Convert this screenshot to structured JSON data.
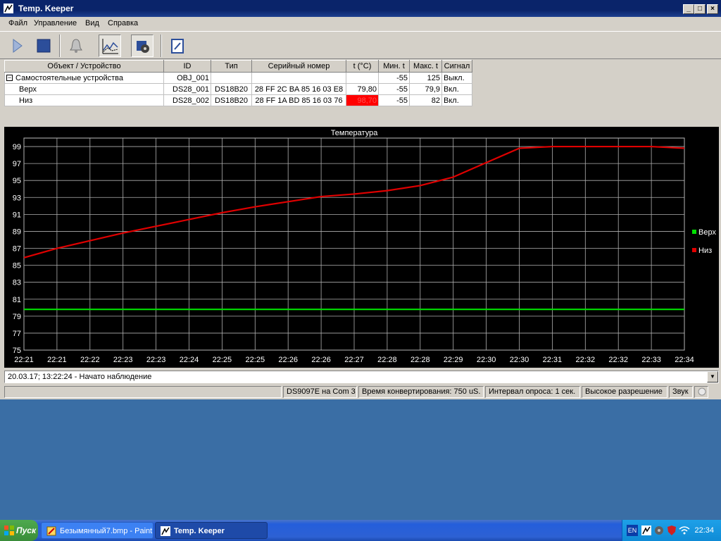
{
  "window": {
    "title": "Temp. Keeper",
    "controls": {
      "minimize": "_",
      "maximize": "□",
      "close": "×"
    }
  },
  "menu": [
    "Файл",
    "Управление",
    "Вид",
    "Справка"
  ],
  "toolbar": {
    "buttons": [
      "play-icon",
      "stop-icon",
      "bell-icon",
      "chart-icon",
      "devices-icon",
      "edit-icon"
    ]
  },
  "table": {
    "headers": [
      "Объект / Устройство",
      "ID",
      "Тип",
      "Серийный номер",
      "t (°C)",
      "Мин. t",
      "Макс. t",
      "Сигнал"
    ],
    "group": {
      "expander": "−",
      "name": "Самостоятельные устройства",
      "id": "OBJ_001",
      "type": "",
      "serial": "",
      "t": "",
      "min": "-55",
      "max": "125",
      "signal": "Выкл."
    },
    "rows": [
      {
        "name": "Верх",
        "id": "DS28_001",
        "type": "DS18B20",
        "serial": "28 FF 2C BA 85 16 03 E8",
        "t": "79,80",
        "min": "-55",
        "max": "79,9",
        "signal": "Вкл.",
        "alarm": false
      },
      {
        "name": "Низ",
        "id": "DS28_002",
        "type": "DS18B20",
        "serial": "28 FF 1A BD 85 16 03 76",
        "t": "98,70",
        "min": "-55",
        "max": "82",
        "signal": "Вкл.",
        "alarm": true
      }
    ]
  },
  "chart_data": {
    "type": "line",
    "title": "Температура",
    "xlabel": "",
    "ylabel": "",
    "ylim": [
      75,
      100
    ],
    "yticks": [
      75,
      77,
      79,
      81,
      83,
      85,
      87,
      89,
      91,
      93,
      95,
      97,
      99
    ],
    "xticks": [
      "22:21",
      "22:21",
      "22:22",
      "22:23",
      "22:23",
      "22:24",
      "22:25",
      "22:25",
      "22:26",
      "22:26",
      "22:27",
      "22:28",
      "22:28",
      "22:29",
      "22:30",
      "22:30",
      "22:31",
      "22:32",
      "22:32",
      "22:33",
      "22:34"
    ],
    "grid": true,
    "legend_position": "right",
    "background": "#000000",
    "series": [
      {
        "name": "Верх",
        "color": "#00e000",
        "x": [
          0,
          1,
          2,
          3,
          4,
          5,
          6,
          7,
          8,
          9,
          10,
          11,
          12,
          13,
          14,
          15,
          16,
          17,
          18,
          19,
          20
        ],
        "y": [
          79.8,
          79.8,
          79.8,
          79.8,
          79.8,
          79.8,
          79.8,
          79.8,
          79.8,
          79.8,
          79.8,
          79.8,
          79.8,
          79.8,
          79.8,
          79.8,
          79.8,
          79.8,
          79.8,
          79.8,
          79.8
        ]
      },
      {
        "name": "Низ",
        "color": "#e00000",
        "x": [
          0,
          1,
          2,
          3,
          4,
          5,
          6,
          7,
          8,
          9,
          10,
          11,
          12,
          13,
          14,
          15,
          16,
          17,
          18,
          19,
          20
        ],
        "y": [
          85.9,
          87.0,
          87.9,
          88.8,
          89.6,
          90.4,
          91.2,
          91.9,
          92.5,
          93.1,
          93.4,
          93.8,
          94.4,
          95.4,
          97.1,
          98.8,
          99.0,
          99.0,
          99.0,
          99.0,
          98.8
        ]
      }
    ]
  },
  "log": {
    "text": "20.03.17; 13:22:24 - Начато наблюдение",
    "dropdown": "▼"
  },
  "status": {
    "port": "DS9097E на Com 3",
    "conversion": "Время конвертирования: 750 uS.",
    "interval": "Интервал опроса: 1 сек.",
    "resolution": "Высокое разрешение",
    "sound": "Звук"
  },
  "taskbar": {
    "start": "Пуск",
    "tasks": [
      {
        "label": "Безымянный7.bmp - Paint",
        "active": false
      },
      {
        "label": "Temp. Keeper",
        "active": true
      }
    ],
    "lang": "EN",
    "clock": "22:34"
  }
}
